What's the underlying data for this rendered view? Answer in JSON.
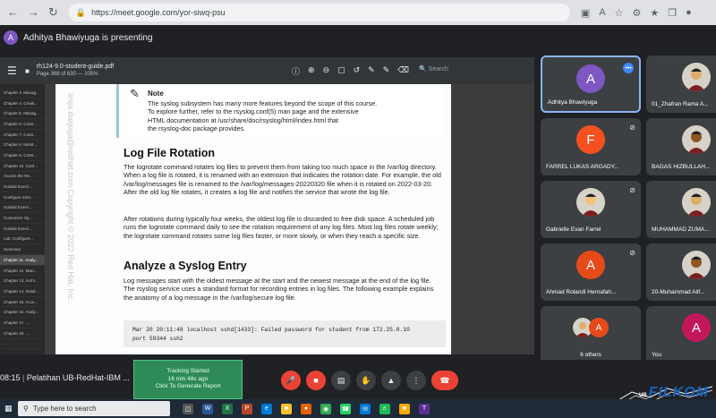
{
  "browser": {
    "url": "https://meet.google.com/yor-siwq-psu"
  },
  "presenting": {
    "initial": "A",
    "text": "Adhitya Bhawiyuga is presenting"
  },
  "pdf": {
    "title": "rh124-9.0-student-guide.pdf",
    "subtitle": "Page 368 of 630 — 105%",
    "search_placeholder": "Search",
    "toc": [
      "Chapter 3. Manag...",
      "Chapter 4. Creati...",
      "Chapter 5. Manag...",
      "Chapter 6. Contr...",
      "Chapter 7. Contr...",
      "Chapter 8. Monit...",
      "Chapter 9. Contr...",
      "Chapter 10. Conf...",
      "Access the Re...",
      "Guided Exerci...",
      "Configure SSH...",
      "Guided Exerci...",
      "Customize Op...",
      "Guided Exerci...",
      "Lab: Configure...",
      "Summary",
      "Chapter 11. Analy...",
      "Chapter 12. Man...",
      "Chapter 13. Archi...",
      "Chapter 14. Instal...",
      "Chapter 15. Acce...",
      "Chapter 16. Analy...",
      "Chapter 17. ...",
      "Chapter 18. ...",
      "..."
    ],
    "toc_selected_index": 16,
    "watermark": "linija.dwijoga@redhat.com  Copyright © 2022 Red Hat, Inc.",
    "note_label": "Note",
    "note_lines": [
      "The syslog subsystem has many more features beyond the scope of this course.",
      "To explore further, refer to the rsyslog.conf(5) man page and the extensive",
      "HTML documentation at /usr/share/doc/rsyslog/html/index.html that",
      "the rsyslog-doc package provides."
    ],
    "heading1": "Log File Rotation",
    "para1": "The logrotate command rotates log files to prevent them from taking too much space in the /var/log directory. When a log file is rotated, it is renamed with an extension that indicates the rotation date. For example, the old /var/log/messages file is renamed to the /var/log/messages-20220320 file when it is rotated on 2022-03-20. After the old log file rotates, it creates a log file and notifies the service that wrote the log file.",
    "para2": "After rotations during typically four weeks, the oldest log file is discarded to free disk space. A scheduled job runs the logrotate command daily to see the rotation requirement of any log files. Most log files rotate weekly; the logrotate command rotates some log files faster, or more slowly, or when they reach a specific size.",
    "heading2": "Analyze a Syslog Entry",
    "para3": "Log messages start with the oldest message at the start and the newest message at the end of the log file. The rsyslog service uses a standard format for recording entries in log files. The following example explains the anatomy of a log message in the /var/log/secure log file.",
    "code_line1": "Mar 20 20:11:48 localhost sshd[1433]: Failed password for student from 172.25.0.10",
    "code_line2": "port 59344 ssh2"
  },
  "participants": [
    {
      "name": "Adhitya Bhawiyuga",
      "initial": "A",
      "color": "#7e57c2",
      "type": "avatar",
      "active": true
    },
    {
      "name": "01_Zhafran Rama A...",
      "type": "photo"
    },
    {
      "name": "FARREL LUKAS ARGADY...",
      "initial": "F",
      "color": "#f4511e",
      "type": "avatar",
      "muted": true
    },
    {
      "name": "BAGAS HIZBULLAH...",
      "type": "photo",
      "muted": true
    },
    {
      "name": "Gabrielle Evan Farrel",
      "type": "photo",
      "muted": true
    },
    {
      "name": "MUHAMMAD ZUMA...",
      "type": "photo"
    },
    {
      "name": "Ahmad Rolandi Hernafah...",
      "initial": "A",
      "color": "#e64a19",
      "type": "avatar",
      "muted": true
    },
    {
      "name": "20-Muhammad Alif...",
      "type": "photo"
    },
    {
      "name": "6 others",
      "type": "group"
    },
    {
      "name": "You",
      "initial": "A",
      "color": "#c2185b",
      "type": "avatar"
    }
  ],
  "bottom": {
    "time": "08:15",
    "meeting_name": "Pelatihan UB-RedHat-IBM ...",
    "tracking_title": "Tracking Started",
    "tracking_time": "16 min 48s ago",
    "tracking_action": "Click To Generate Report"
  },
  "logo": {
    "text": "FILKOM",
    "prefix": "UB",
    "tagline": "FAKULTAS ILMU KOMPUTER"
  },
  "taskbar": {
    "search_placeholder": "Type here to search"
  }
}
